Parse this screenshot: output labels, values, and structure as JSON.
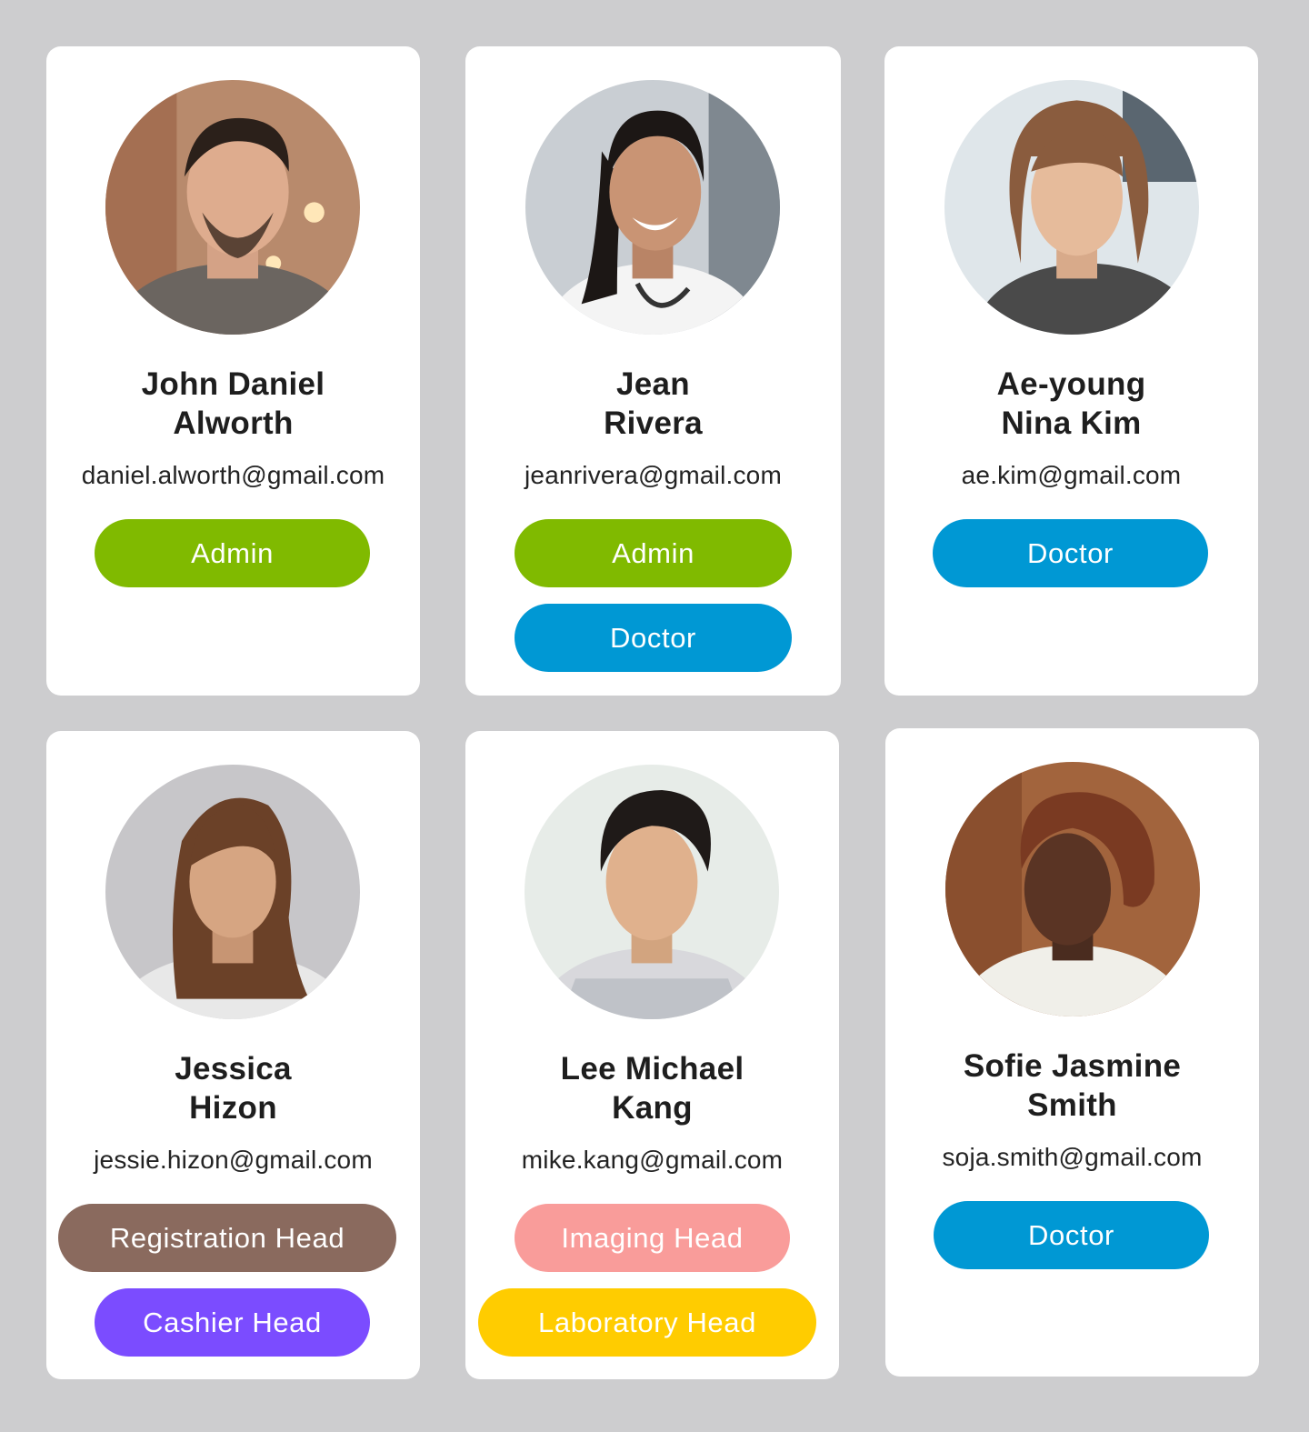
{
  "colors": {
    "page_background": "#cdcdcf",
    "card_background": "#ffffff",
    "role_admin": "#80ba00",
    "role_doctor": "#0098d4",
    "role_registration_head": "#8a6a5e",
    "role_cashier_head": "#7b4cff",
    "role_imaging_head": "#f99c9a",
    "role_laboratory_head": "#ffcc00"
  },
  "users": [
    {
      "name_line1": "John Daniel",
      "name_line2": "Alworth",
      "email": "daniel.alworth@gmail.com",
      "roles": [
        "Admin"
      ]
    },
    {
      "name_line1": "Jean",
      "name_line2": "Rivera",
      "email": "jeanrivera@gmail.com",
      "roles": [
        "Admin",
        "Doctor"
      ]
    },
    {
      "name_line1": "Ae-young",
      "name_line2": "Nina Kim",
      "email": "ae.kim@gmail.com",
      "roles": [
        "Doctor"
      ]
    },
    {
      "name_line1": "Jessica",
      "name_line2": "Hizon",
      "email": "jessie.hizon@gmail.com",
      "roles": [
        "Registration Head",
        "Cashier Head"
      ]
    },
    {
      "name_line1": "Lee Michael",
      "name_line2": "Kang",
      "email": "mike.kang@gmail.com",
      "roles": [
        "Imaging Head",
        "Laboratory Head"
      ]
    },
    {
      "name_line1": "Sofie Jasmine",
      "name_line2": "Smith",
      "email": "soja.smith@gmail.com",
      "roles": [
        "Doctor"
      ]
    }
  ]
}
